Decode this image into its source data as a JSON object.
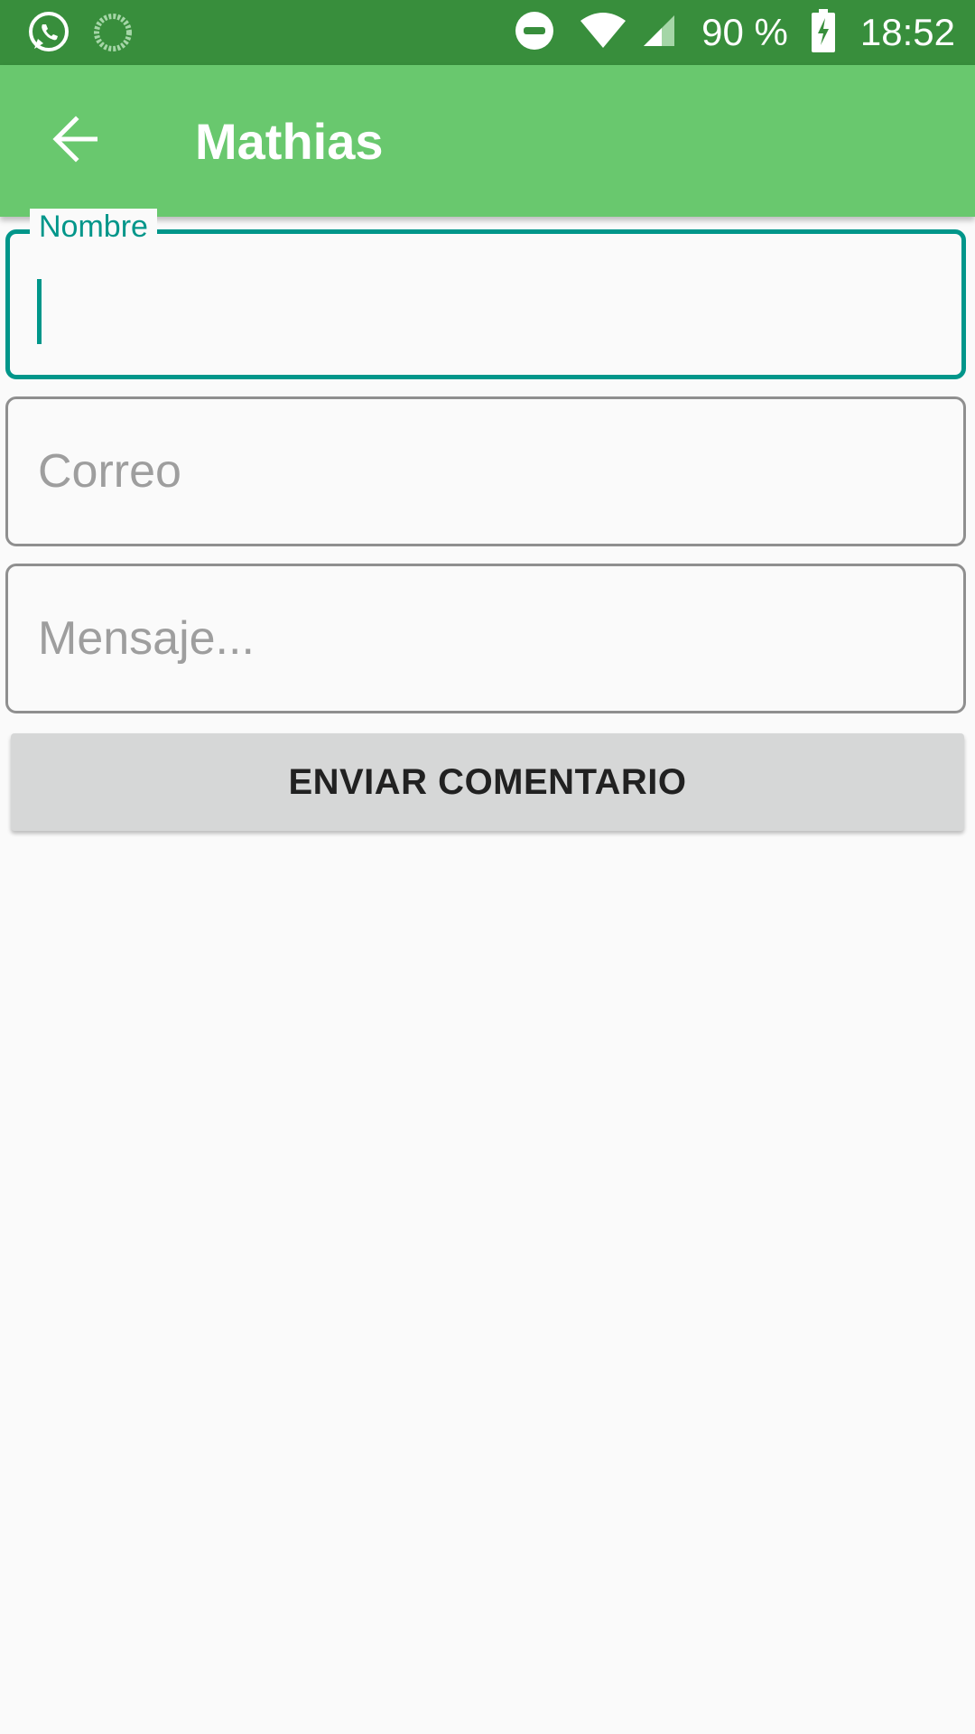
{
  "status_bar": {
    "left_icons": [
      "whatsapp-icon",
      "sync-progress-icon"
    ],
    "right_icons": [
      "do-not-disturb-icon",
      "wifi-icon",
      "cell-signal-icon",
      "battery-charging-icon"
    ],
    "battery_text": "90 %",
    "time": "18:52"
  },
  "app_bar": {
    "back_icon": "arrow-back-icon",
    "title": "Mathias"
  },
  "form": {
    "name_field": {
      "label": "Nombre",
      "value": "",
      "focused": true
    },
    "email_field": {
      "placeholder": "Correo",
      "value": ""
    },
    "message_field": {
      "placeholder": "Mensaje...",
      "value": ""
    },
    "submit_label": "ENVIAR COMENTARIO"
  },
  "colors": {
    "status_bar": "#388e3c",
    "app_bar": "#69c86e",
    "accent": "#00968a",
    "button": "#d6d7d7",
    "background": "#fafafa"
  }
}
